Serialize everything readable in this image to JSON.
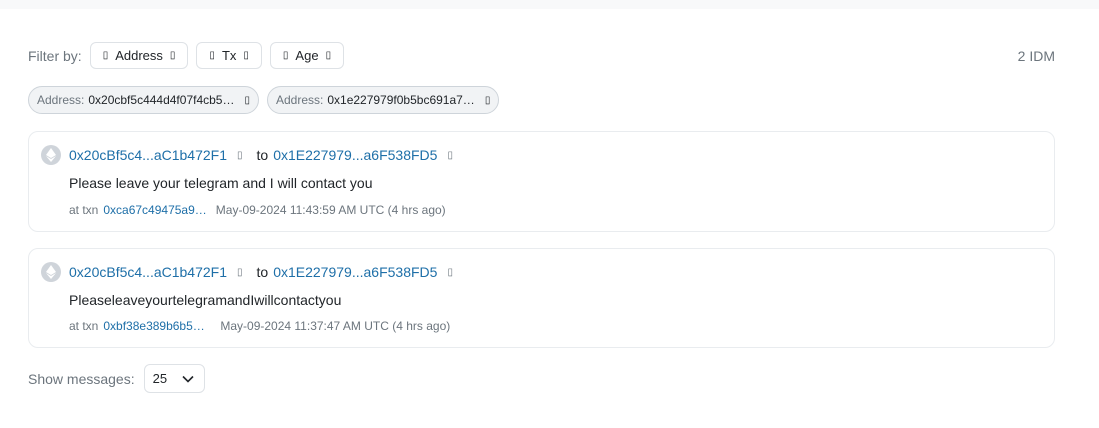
{
  "filter": {
    "label": "Filter by:",
    "buttons": [
      {
        "label": "Address",
        "icon": "filter-icon",
        "trail_icon": "chevron-down-icon"
      },
      {
        "label": "Tx",
        "icon": "filter-icon",
        "trail_icon": "chevron-down-icon"
      },
      {
        "label": "Age",
        "icon": "filter-icon",
        "trail_icon": "chevron-down-icon"
      }
    ],
    "count": "2 IDM"
  },
  "chips": [
    {
      "key": "Address:",
      "value": "0x20cbf5c444d4f07f4cb5…",
      "icon": "close-icon"
    },
    {
      "key": "Address:",
      "value": "0x1e227979f0b5bc691a7…",
      "icon": "close-icon"
    }
  ],
  "messages": [
    {
      "from": "0x20cBf5c4...aC1b472F1",
      "to_word": "to",
      "to": "0x1E227979...a6F538FD5",
      "text": "Please leave your telegram and I will contact you",
      "at_txn_label": "at txn",
      "txn": "0xca67c49475a9…",
      "time": "May-09-2024 11:43:59 AM UTC (4 hrs ago)"
    },
    {
      "from": "0x20cBf5c4...aC1b472F1",
      "to_word": "to",
      "to": "0x1E227979...a6F538FD5",
      "text": "PleaseleaveyourtelegramandIwillcontactyou",
      "at_txn_label": "at txn",
      "txn": "0xbf38e389b6b58…",
      "time": "May-09-2024 11:37:47 AM UTC (4 hrs ago)"
    }
  ],
  "pagination": {
    "label": "Show messages:",
    "value": "25"
  },
  "glyphs": {
    "box": "▯",
    "chevron": "⌄"
  },
  "colors": {
    "link": "#1e6fa8",
    "muted": "#6c757d",
    "border": "#dee2e6"
  }
}
